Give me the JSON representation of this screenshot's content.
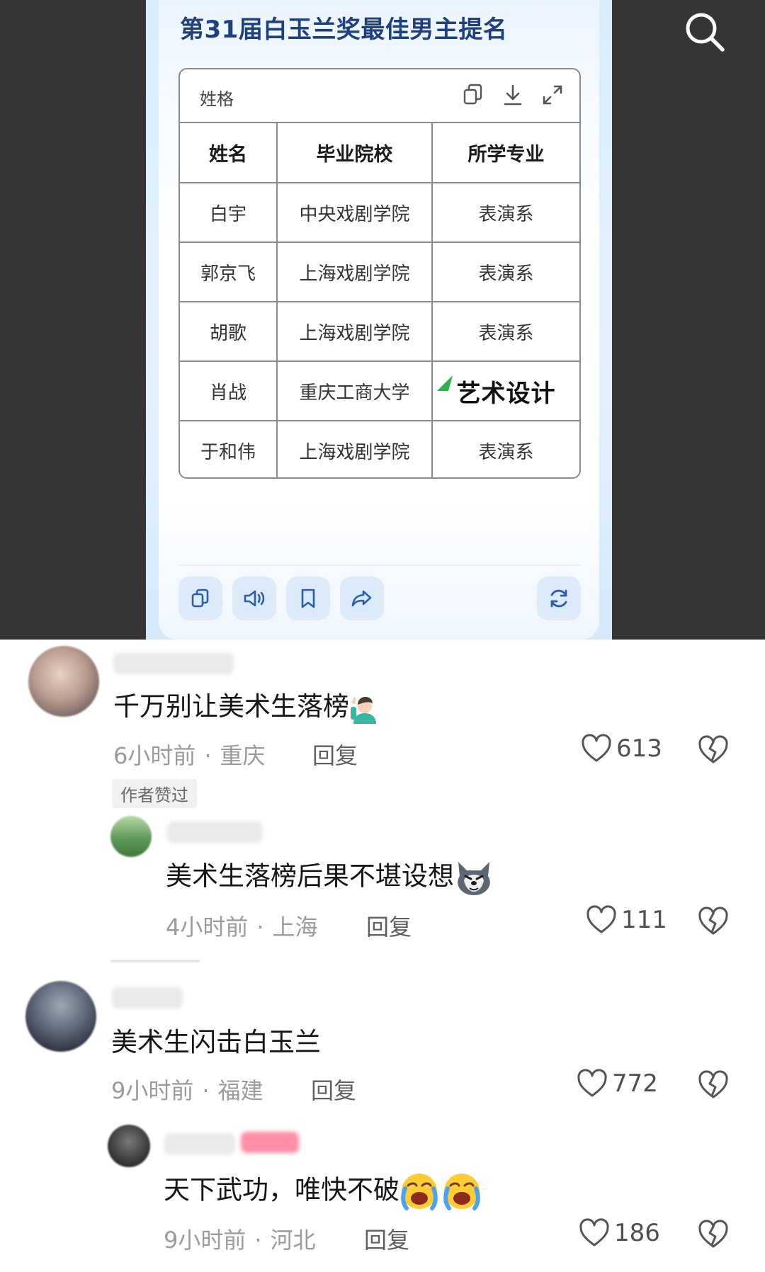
{
  "video": {
    "card_title": "第31届白玉兰奖最佳男主提名",
    "table_caption": "姓格",
    "tools": [
      "copy-icon",
      "download-icon",
      "expand-icon"
    ],
    "table": {
      "headers": [
        "姓名",
        "毕业院校",
        "所学专业"
      ],
      "rows": [
        [
          "白宇",
          "中央戏剧学院",
          "表演系"
        ],
        [
          "郭京飞",
          "上海戏剧学院",
          "表演系"
        ],
        [
          "胡歌",
          "上海戏剧学院",
          "表演系"
        ],
        [
          "肖战",
          "重庆工商大学",
          "艺术设计"
        ],
        [
          "于和伟",
          "上海戏剧学院",
          "表演系"
        ]
      ]
    },
    "actions": [
      "copy-icon",
      "speaker-icon",
      "bookmark-icon",
      "share-icon",
      "refresh-icon"
    ]
  },
  "comments": [
    {
      "text": "千万别让美术生落榜",
      "emoji": "person-raising-hand-emoji",
      "time": "6小时前",
      "location": "重庆",
      "reply": "回复",
      "likes": "613",
      "tag": "作者赞过"
    },
    {
      "text": "美术生落榜后果不堪设想",
      "emoji": "wolf-face-emoji",
      "time": "4小时前",
      "location": "上海",
      "reply": "回复",
      "likes": "111"
    },
    {
      "text": "美术生闪击白玉兰",
      "time": "9小时前",
      "location": "福建",
      "reply": "回复",
      "likes": "772"
    },
    {
      "text": "天下武功，唯快不破",
      "emoji": "loudly-crying-face-emoji",
      "time": "9小时前",
      "location": "河北",
      "reply": "回复",
      "likes": "186"
    }
  ]
}
